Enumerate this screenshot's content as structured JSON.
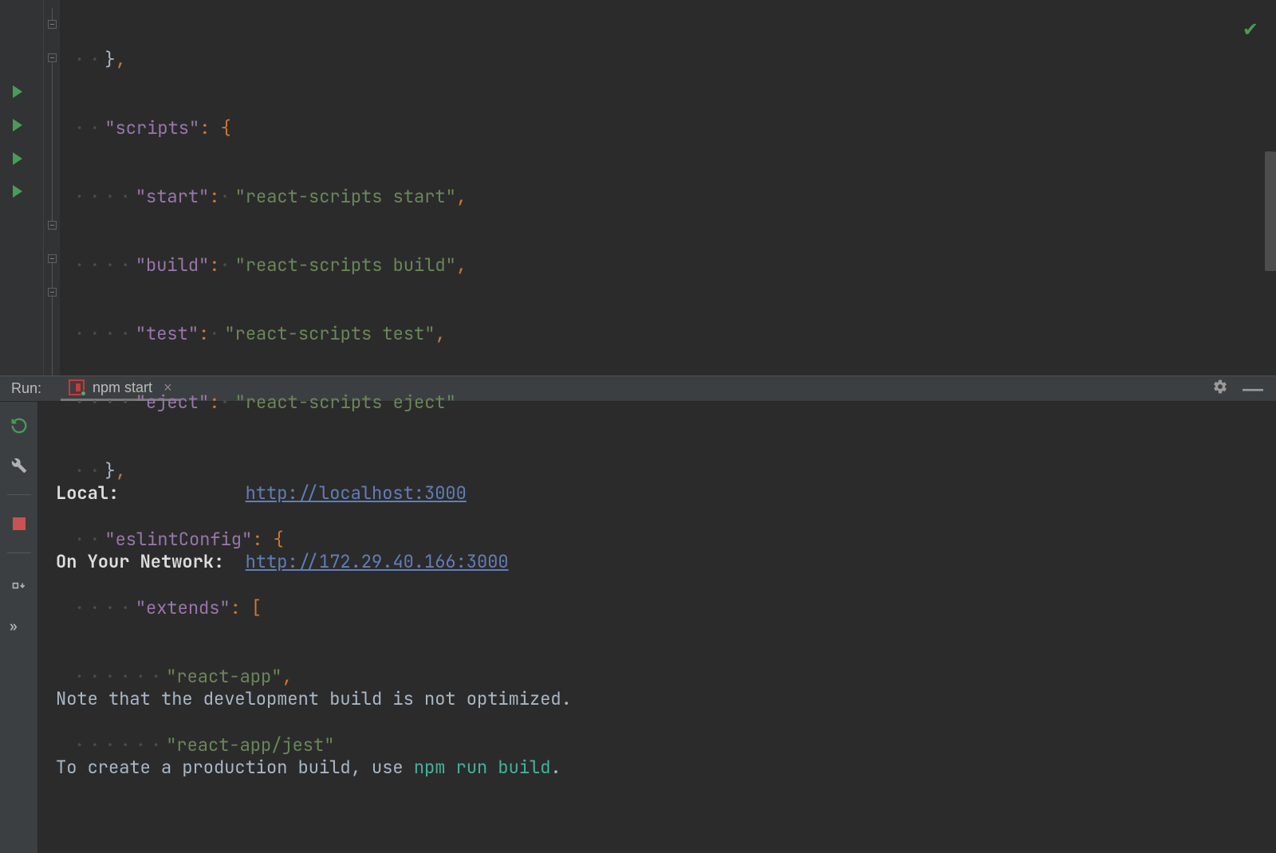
{
  "editor": {
    "lines": {
      "l1": "},",
      "l2_key": "\"scripts\"",
      "l2_rest": ": {",
      "l3_key": "\"start\"",
      "l3_val": "\"react-scripts start\"",
      "l4_key": "\"build\"",
      "l4_val": "\"react-scripts build\"",
      "l5_key": "\"test\"",
      "l5_val": "\"react-scripts test\"",
      "l6_key": "\"eject\"",
      "l6_val": "\"react-scripts eject\"",
      "l7": "},",
      "l8_key": "\"eslintConfig\"",
      "l8_rest": ": {",
      "l9_key": "\"extends\"",
      "l9_rest": ": [",
      "l10_val": "\"react-app\"",
      "l11_val": "\"react-app/jest\""
    }
  },
  "runPanel": {
    "label": "Run:",
    "tabName": "npm start",
    "console": {
      "localLabel": "Local:",
      "localUrl": "http://localhost:3000",
      "networkLabel": "On Your Network:",
      "networkUrl": "http://172.29.40.166:3000",
      "note1": "Note that the development build is not optimized.",
      "note2a": "To create a production build, use ",
      "note2cmd": "npm run build",
      "note2b": "."
    }
  }
}
